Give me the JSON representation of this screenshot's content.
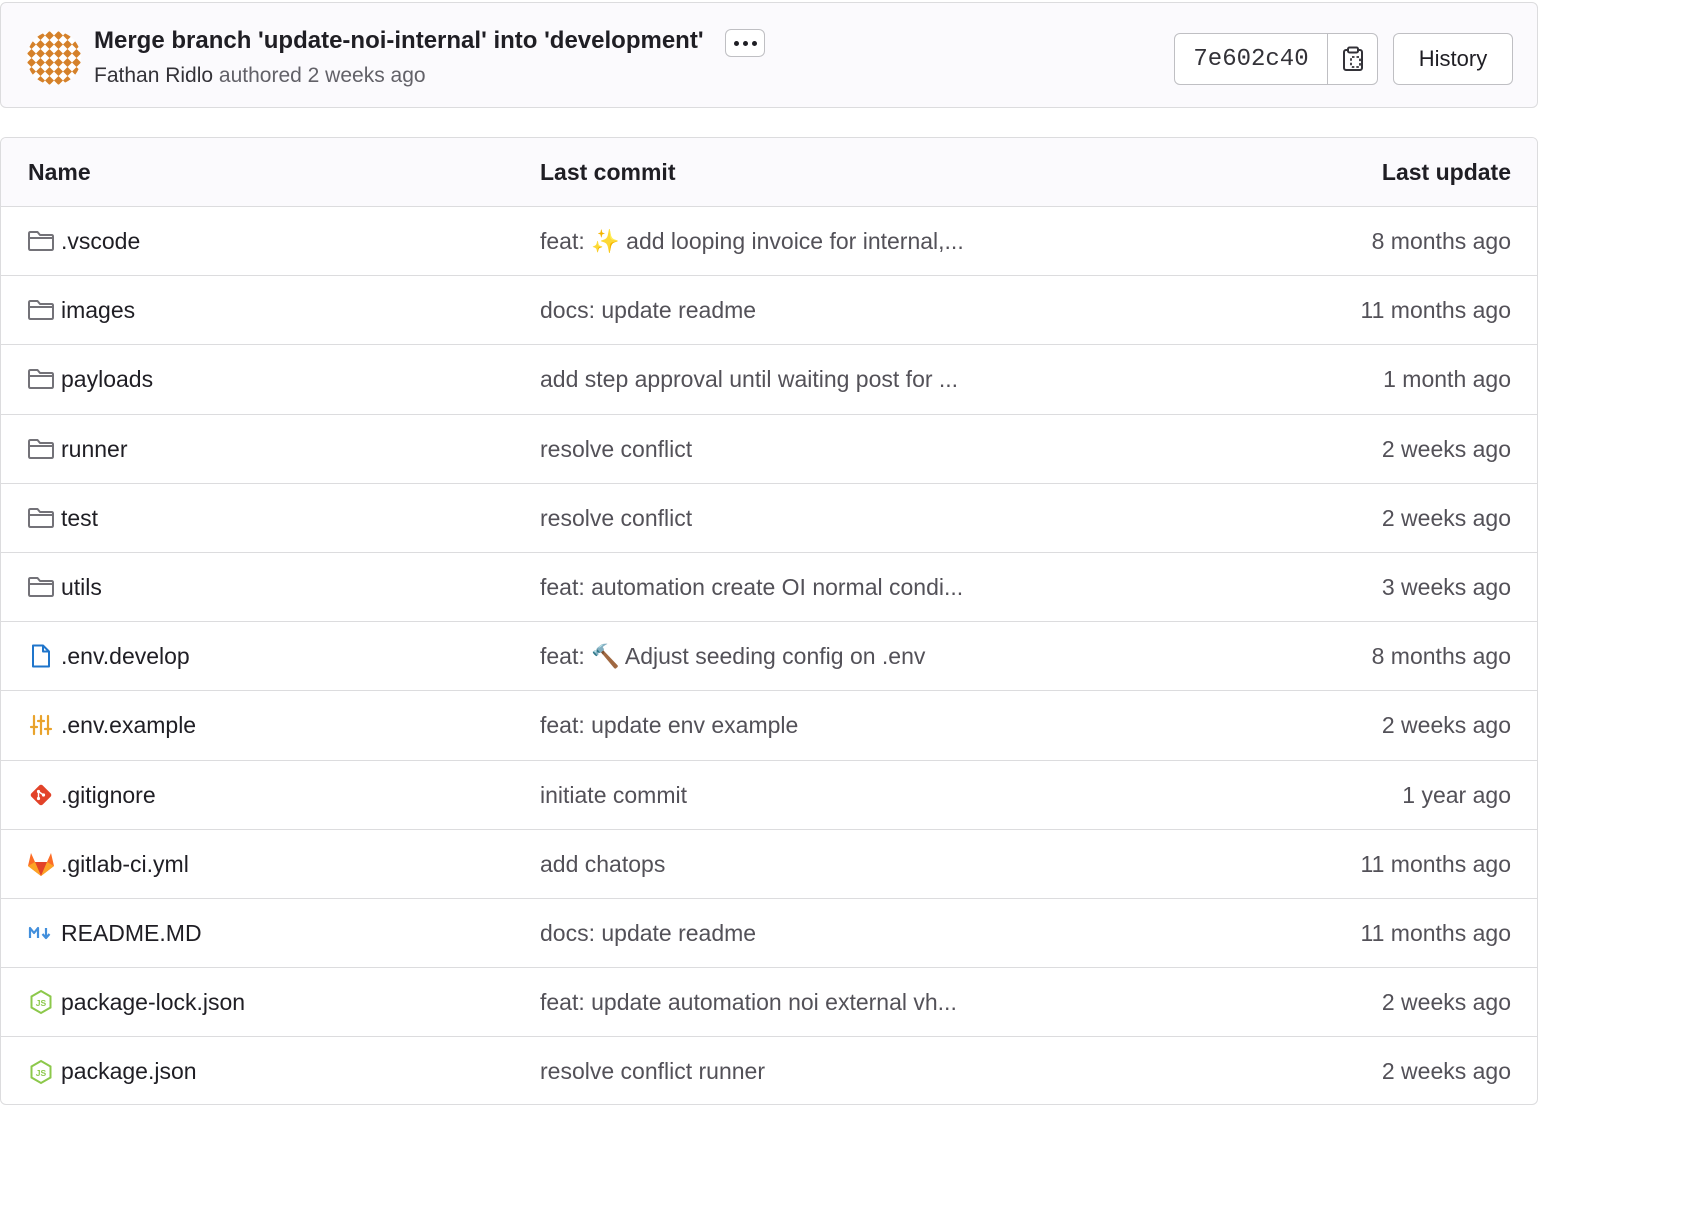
{
  "commit": {
    "title": "Merge branch 'update-noi-internal' into 'development'",
    "author": "Fathan Ridlo",
    "authored_text": "authored",
    "time": "2 weeks ago",
    "sha": "7e602c40",
    "history_label": "History"
  },
  "table": {
    "headers": {
      "name": "Name",
      "last_commit": "Last commit",
      "last_update": "Last update"
    },
    "rows": [
      {
        "icon": "folder-icon",
        "name": ".vscode",
        "commit": "feat: ✨ add looping invoice for internal,...",
        "updated": "8 months ago"
      },
      {
        "icon": "folder-icon",
        "name": "images",
        "commit": "docs: update readme",
        "updated": "11 months ago"
      },
      {
        "icon": "folder-icon",
        "name": "payloads",
        "commit": "add step approval until waiting post for ...",
        "updated": "1 month ago"
      },
      {
        "icon": "folder-icon",
        "name": "runner",
        "commit": "resolve conflict",
        "updated": "2 weeks ago"
      },
      {
        "icon": "folder-icon",
        "name": "test",
        "commit": "resolve conflict",
        "updated": "2 weeks ago"
      },
      {
        "icon": "folder-icon",
        "name": "utils",
        "commit": "feat: automation create OI normal condi...",
        "updated": "3 weeks ago"
      },
      {
        "icon": "file-icon",
        "name": ".env.develop",
        "commit": "feat: 🔨 Adjust seeding config on .env",
        "updated": "8 months ago"
      },
      {
        "icon": "settings-sliders-icon",
        "name": ".env.example",
        "commit": "feat: update env example",
        "updated": "2 weeks ago"
      },
      {
        "icon": "git-icon",
        "name": ".gitignore",
        "commit": "initiate commit",
        "updated": "1 year ago"
      },
      {
        "icon": "gitlab-icon",
        "name": ".gitlab-ci.yml",
        "commit": "add chatops",
        "updated": "11 months ago"
      },
      {
        "icon": "markdown-icon",
        "name": "README.MD",
        "commit": "docs: update readme",
        "updated": "11 months ago"
      },
      {
        "icon": "nodejs-icon",
        "name": "package-lock.json",
        "commit": "feat: update automation noi external vh...",
        "updated": "2 weeks ago"
      },
      {
        "icon": "nodejs-icon",
        "name": "package.json",
        "commit": "resolve conflict runner",
        "updated": "2 weeks ago"
      }
    ]
  },
  "colors": {
    "folder": "#737278",
    "file": "#1f75cb",
    "env": "#e9a32c",
    "git": "#e24329",
    "gitlab": "#fc6d26",
    "markdown": "#428fdc",
    "nodejs": "#8cc84b"
  }
}
